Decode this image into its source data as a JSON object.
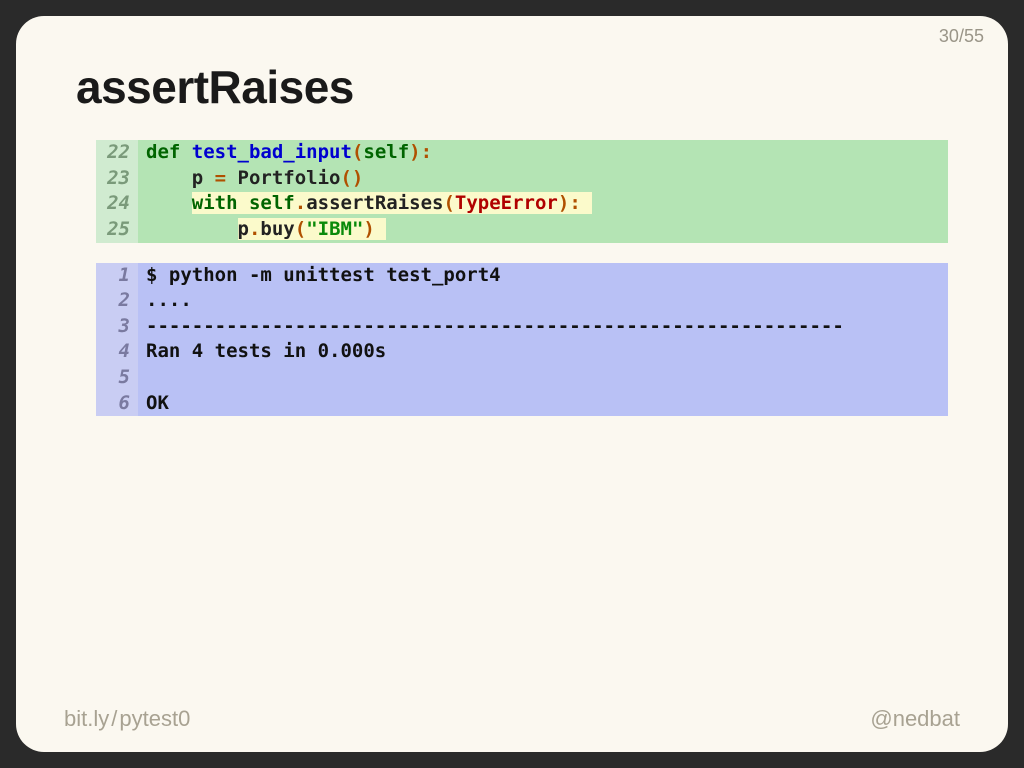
{
  "pager": {
    "current": "30",
    "sep": "/",
    "total": "55"
  },
  "title": "assertRaises",
  "code1": {
    "lines": [
      {
        "n": "22",
        "hl": false,
        "tokens": [
          {
            "t": "def ",
            "c": "kw"
          },
          {
            "t": "test_bad_input",
            "c": "fn"
          },
          {
            "t": "(",
            "c": "op"
          },
          {
            "t": "self",
            "c": "self"
          },
          {
            "t": ")",
            "c": "op"
          },
          {
            "t": ":",
            "c": "op"
          }
        ]
      },
      {
        "n": "23",
        "hl": false,
        "tokens": [
          {
            "t": "    p ",
            "c": "nm"
          },
          {
            "t": "=",
            "c": "op"
          },
          {
            "t": " Portfolio",
            "c": "nm"
          },
          {
            "t": "()",
            "c": "op"
          }
        ]
      },
      {
        "n": "24",
        "hl": true,
        "tokens": [
          {
            "t": "    ",
            "c": "nm"
          },
          {
            "t": "with ",
            "c": "kw"
          },
          {
            "t": "self",
            "c": "self"
          },
          {
            "t": ".",
            "c": "op"
          },
          {
            "t": "assertRaises",
            "c": "nm"
          },
          {
            "t": "(",
            "c": "op"
          },
          {
            "t": "TypeError",
            "c": "exc"
          },
          {
            "t": ")",
            "c": "op"
          },
          {
            "t": ":",
            "c": "op"
          }
        ]
      },
      {
        "n": "25",
        "hl": true,
        "tokens": [
          {
            "t": "        p",
            "c": "nm"
          },
          {
            "t": ".",
            "c": "op"
          },
          {
            "t": "buy",
            "c": "nm"
          },
          {
            "t": "(",
            "c": "op"
          },
          {
            "t": "\"IBM\"",
            "c": "str"
          },
          {
            "t": ")",
            "c": "op"
          }
        ]
      }
    ]
  },
  "code2": {
    "lines": [
      {
        "n": "1",
        "text": "$ python -m unittest test_port4"
      },
      {
        "n": "2",
        "text": "...."
      },
      {
        "n": "3",
        "text": "-------------------------------------------------------------"
      },
      {
        "n": "4",
        "text": "Ran 4 tests in 0.000s"
      },
      {
        "n": "5",
        "text": ""
      },
      {
        "n": "6",
        "text": "OK"
      }
    ]
  },
  "footer": {
    "left1": "bit.ly",
    "slash": "/",
    "left2": "pytest0",
    "right": "@nedbat"
  }
}
